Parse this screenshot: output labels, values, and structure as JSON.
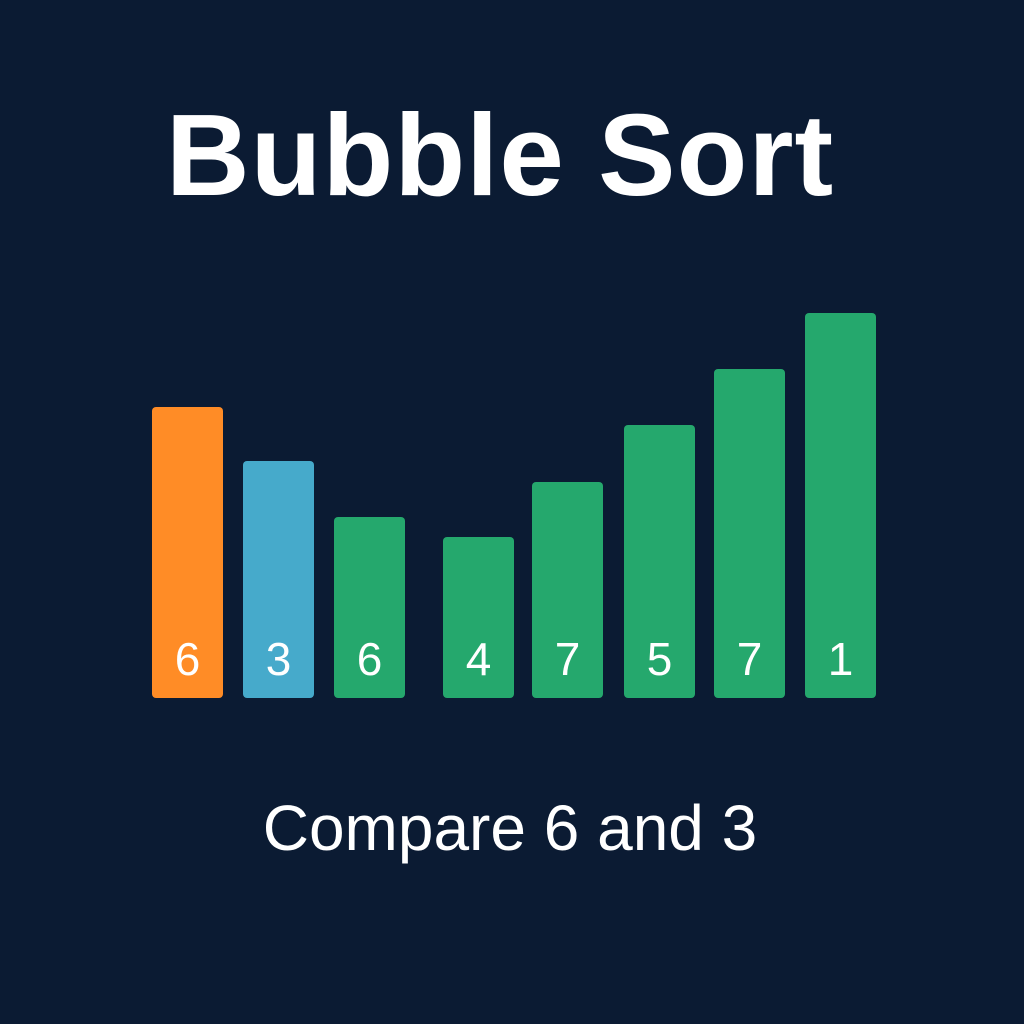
{
  "title": "Bubble Sort",
  "caption": "Compare 6 and 3",
  "colors": {
    "background": "#0b1b33",
    "comparing_left": "#ff8c26",
    "comparing_right": "#46aacb",
    "default": "#25a86d",
    "text": "#ffffff"
  },
  "bars": [
    {
      "label": "6",
      "relative_height": 0.756,
      "state": "comparing_left"
    },
    {
      "label": "3",
      "relative_height": 0.615,
      "state": "comparing_right"
    },
    {
      "label": "6",
      "relative_height": 0.469,
      "state": "default"
    },
    {
      "label": "4",
      "relative_height": 0.417,
      "state": "default"
    },
    {
      "label": "7",
      "relative_height": 0.56,
      "state": "default"
    },
    {
      "label": "5",
      "relative_height": 0.708,
      "state": "default"
    },
    {
      "label": "7",
      "relative_height": 0.854,
      "state": "default"
    },
    {
      "label": "1",
      "relative_height": 1.0,
      "state": "default"
    }
  ]
}
